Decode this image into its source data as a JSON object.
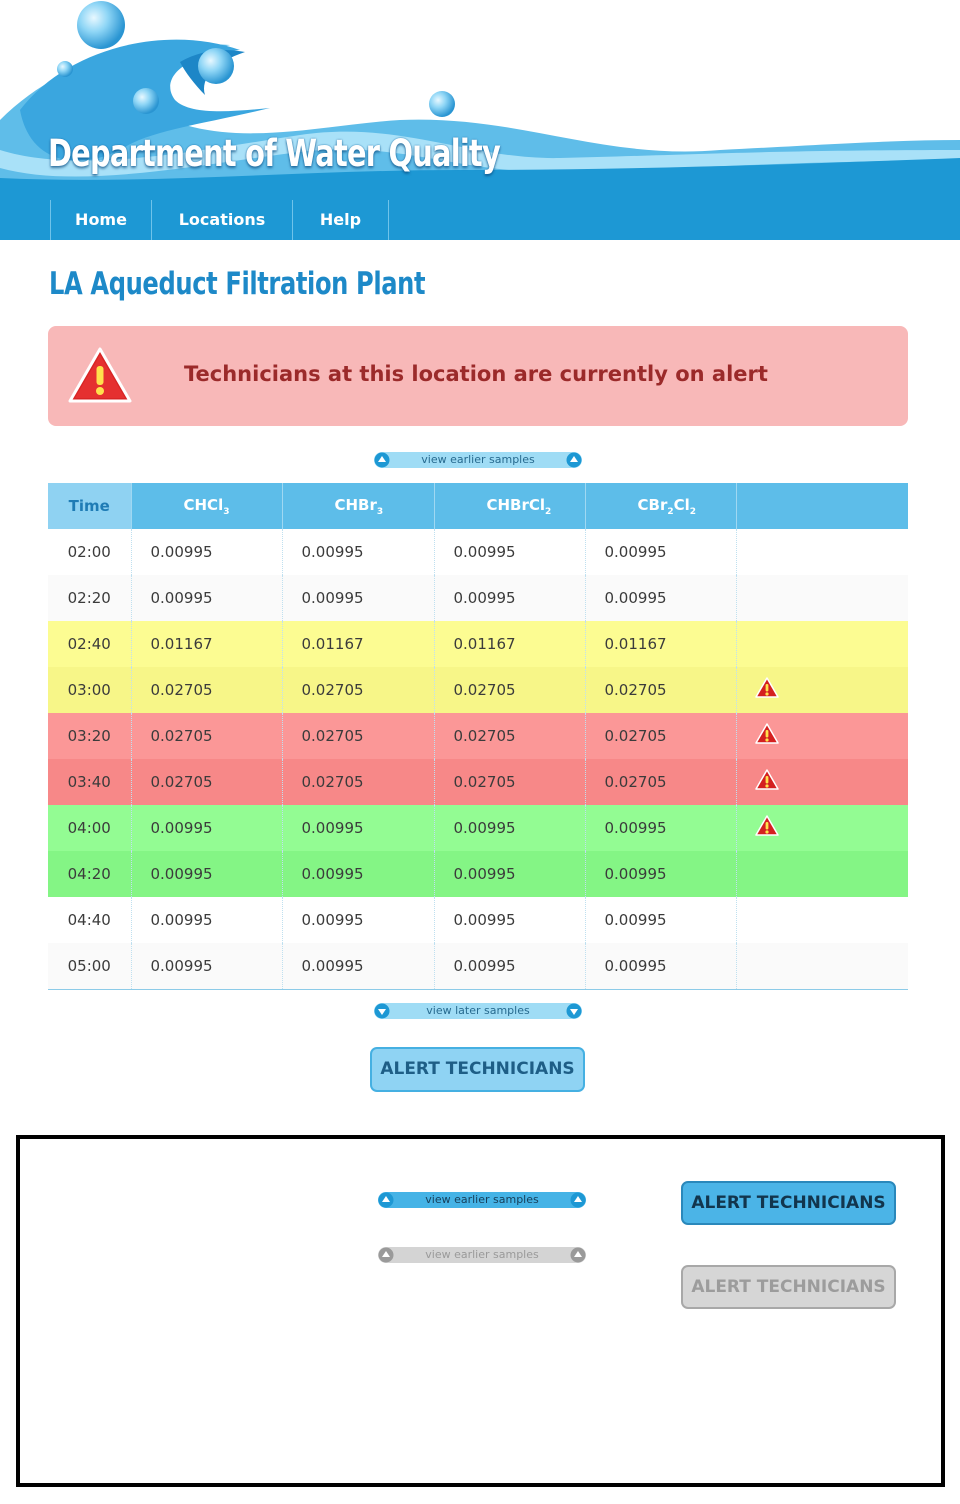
{
  "header": {
    "site_title": "Department of Water Quality",
    "nav": [
      "Home",
      "Locations",
      "Help"
    ]
  },
  "page": {
    "title": "LA Aqueduct Filtration Plant"
  },
  "alert_banner": {
    "icon": "warning-triangle-icon",
    "text": "Technicians at this location are currently on alert"
  },
  "pagination": {
    "earlier_label": "view earlier samples",
    "later_label": "view later samples"
  },
  "table": {
    "columns": [
      {
        "base": "Time",
        "sub": ""
      },
      {
        "base": "CHCl",
        "sub": "3"
      },
      {
        "base": "CHBr",
        "sub": "3"
      },
      {
        "base": "CHBrCl",
        "sub": "2"
      },
      {
        "base": "CBr",
        "sub": "2",
        "tail": "Cl",
        "tail_sub": "2"
      },
      {
        "base": "",
        "sub": ""
      }
    ],
    "rows": [
      {
        "time": "02:00",
        "values": [
          "0.00995",
          "0.00995",
          "0.00995",
          "0.00995"
        ],
        "warning": false,
        "status": "normal"
      },
      {
        "time": "02:20",
        "values": [
          "0.00995",
          "0.00995",
          "0.00995",
          "0.00995"
        ],
        "warning": false,
        "status": "normal"
      },
      {
        "time": "02:40",
        "values": [
          "0.01167",
          "0.01167",
          "0.01167",
          "0.01167"
        ],
        "warning": false,
        "status": "elevated"
      },
      {
        "time": "03:00",
        "values": [
          "0.02705",
          "0.02705",
          "0.02705",
          "0.02705"
        ],
        "warning": true,
        "status": "elevated"
      },
      {
        "time": "03:20",
        "values": [
          "0.02705",
          "0.02705",
          "0.02705",
          "0.02705"
        ],
        "warning": true,
        "status": "critical"
      },
      {
        "time": "03:40",
        "values": [
          "0.02705",
          "0.02705",
          "0.02705",
          "0.02705"
        ],
        "warning": true,
        "status": "critical"
      },
      {
        "time": "04:00",
        "values": [
          "0.00995",
          "0.00995",
          "0.00995",
          "0.00995"
        ],
        "warning": true,
        "status": "recovered"
      },
      {
        "time": "04:20",
        "values": [
          "0.00995",
          "0.00995",
          "0.00995",
          "0.00995"
        ],
        "warning": false,
        "status": "recovered"
      },
      {
        "time": "04:40",
        "values": [
          "0.00995",
          "0.00995",
          "0.00995",
          "0.00995"
        ],
        "warning": false,
        "status": "normal"
      },
      {
        "time": "05:00",
        "values": [
          "0.00995",
          "0.00995",
          "0.00995",
          "0.00995"
        ],
        "warning": false,
        "status": "normal"
      }
    ]
  },
  "actions": {
    "alert_label": "ALERT TECHNICIANS"
  },
  "states_panel": {
    "pressed_pill_label": "view earlier samples",
    "disabled_pill_label": "view earlier samples",
    "pressed_button_label": "ALERT TECHNICIANS",
    "disabled_button_label": "ALERT TECHNICIANS"
  },
  "colors": {
    "brand_blue": "#1d98d4",
    "header_light": "#5dbde9",
    "alert_bg": "#f8b8b8",
    "alert_text": "#9b2a2a",
    "row_elevated": "#fcfc92",
    "row_critical": "#fb9797",
    "row_recovered": "#93fc93"
  }
}
